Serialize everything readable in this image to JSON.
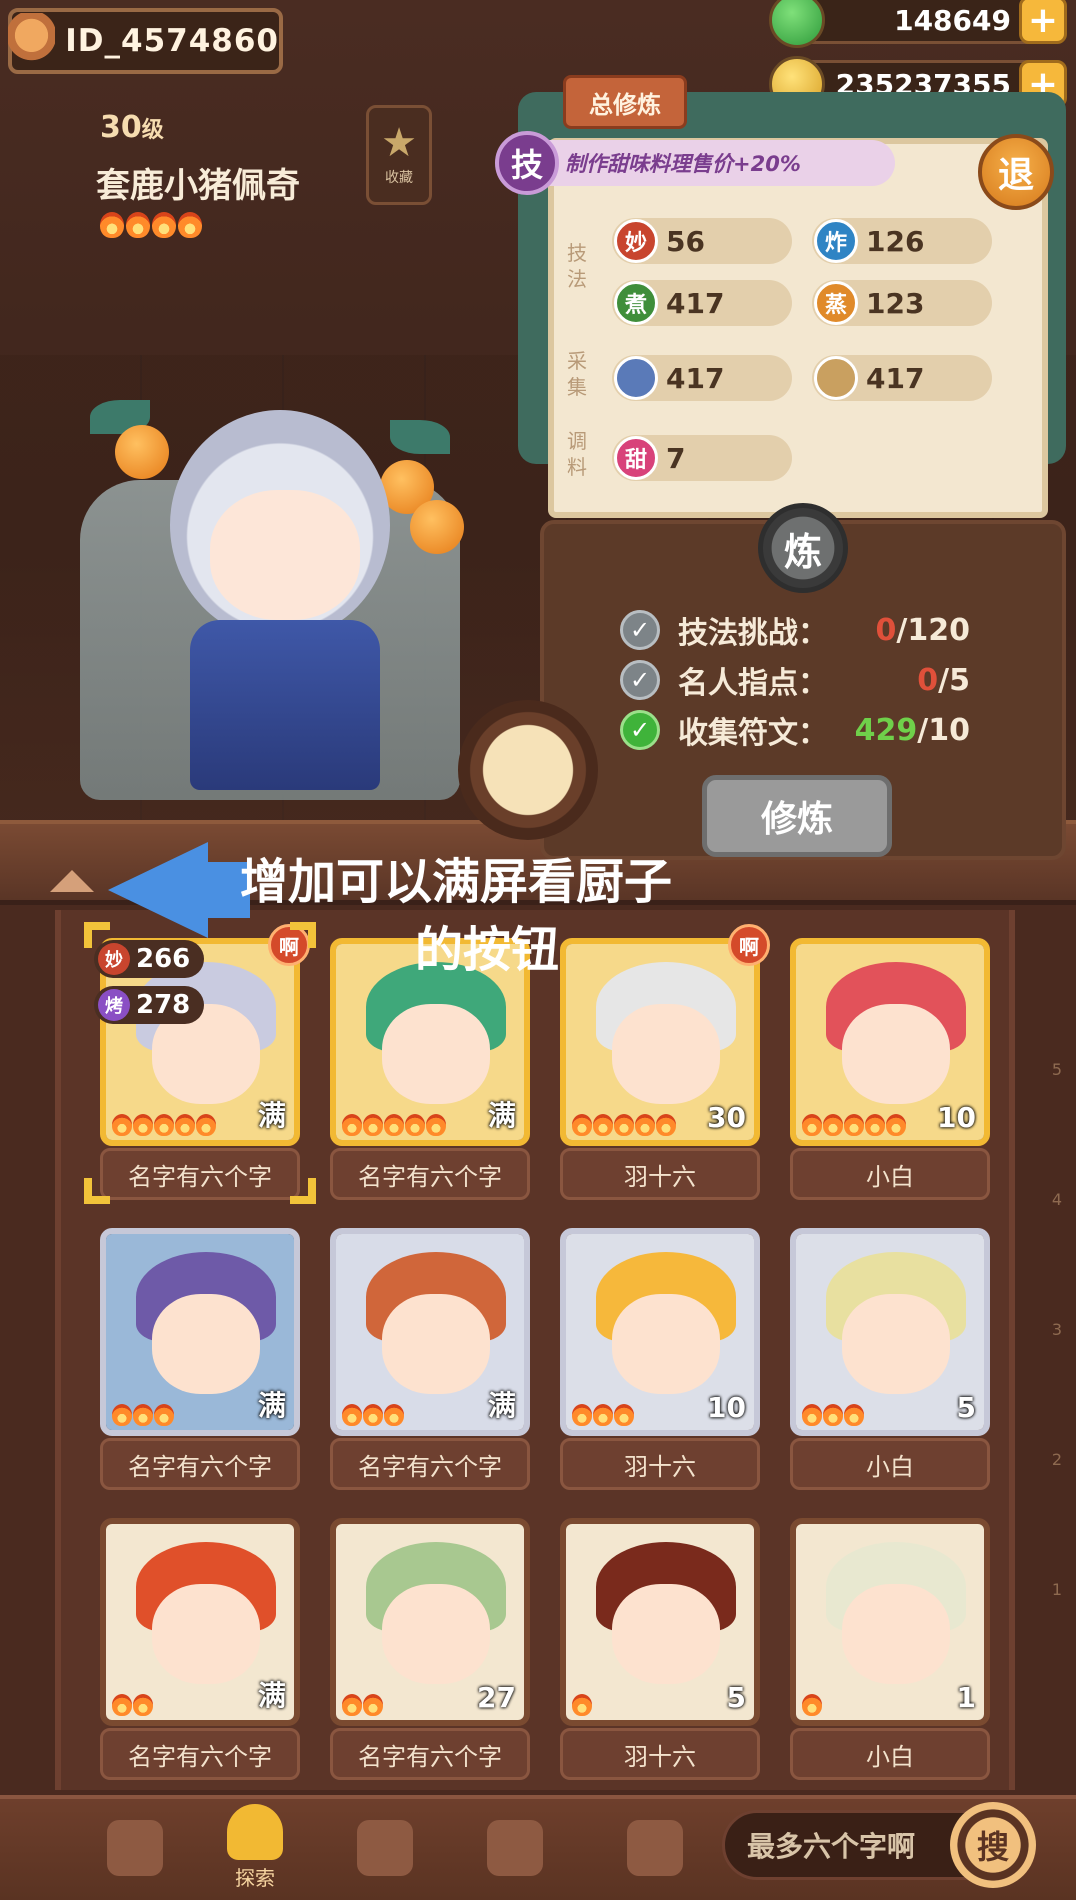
{
  "header": {
    "player_id": "ID_4574860",
    "currency_1": {
      "value": "148649",
      "icon": "jade-coin-icon"
    },
    "currency_2": {
      "value": "235237355",
      "icon": "gold-coin-icon"
    },
    "plus_label": "+"
  },
  "chef": {
    "level_number": "30",
    "level_suffix": "级",
    "name": "套鹿小猪佩奇",
    "flames": 4,
    "collect_label": "收藏"
  },
  "board": {
    "total_btn": "总修炼",
    "buff_badge": "技",
    "buff_text": "制作甜味料理售价+20%",
    "quit_btn": "退",
    "categories": {
      "technique": "技法",
      "gather": "采集",
      "season": "调料"
    },
    "stats": [
      {
        "icon": "妙",
        "value": "56",
        "color": "#c8452e"
      },
      {
        "icon": "炸",
        "value": "126",
        "color": "#2f84c4"
      },
      {
        "icon": "煮",
        "value": "417",
        "color": "#3f8e3a"
      },
      {
        "icon": "蒸",
        "value": "123",
        "color": "#e08a2a"
      },
      {
        "icon": "",
        "value": "417",
        "color": "#5a7ab8"
      },
      {
        "icon": "",
        "value": "417",
        "color": "#c9a060"
      },
      {
        "icon": "甜",
        "value": "7",
        "color": "#d8427a"
      }
    ]
  },
  "training": {
    "badge": "炼",
    "tasks": [
      {
        "label": "技法挑战：",
        "current": "0",
        "total": "/120",
        "done": false
      },
      {
        "label": "名人指点：",
        "current": "0",
        "total": "/5",
        "done": false
      },
      {
        "label": "收集符文：",
        "current": "429",
        "total": "/10",
        "done": true
      }
    ],
    "check_mark": "✓",
    "button": "修炼"
  },
  "annotation": {
    "line1": "增加可以满屏看厨子",
    "line2": "的按钮"
  },
  "selected_skills": [
    {
      "icon": "妙",
      "value": "266",
      "color": "#c8452e"
    },
    {
      "icon": "烤",
      "value": "278",
      "color": "#8a4fc4"
    }
  ],
  "cards": [
    {
      "name": "名字有六个字",
      "level": "满",
      "flames": 5,
      "frame": "gold",
      "tag": "啊",
      "hair": "#c9cbe0",
      "bg": "#f6d98a",
      "selected": true
    },
    {
      "name": "名字有六个字",
      "level": "满",
      "flames": 5,
      "frame": "gold",
      "tag": "",
      "hair": "#3fa87a",
      "bg": "#f6d98a",
      "selected": false
    },
    {
      "name": "羽十六",
      "level": "30",
      "flames": 5,
      "frame": "gold",
      "tag": "啊",
      "hair": "#e6e6e6",
      "bg": "#f6d98a",
      "selected": false
    },
    {
      "name": "小白",
      "level": "10",
      "flames": 5,
      "frame": "gold",
      "tag": "",
      "hair": "#e2525a",
      "bg": "#f6d98a",
      "selected": false
    },
    {
      "name": "名字有六个字",
      "level": "满",
      "flames": 3,
      "frame": "silver",
      "tag": "",
      "hair": "#6e5aa8",
      "bg": "#9ab8d8",
      "selected": false
    },
    {
      "name": "名字有六个字",
      "level": "满",
      "flames": 3,
      "frame": "silver",
      "tag": "",
      "hair": "#d0663a",
      "bg": "#d8dce8",
      "selected": false
    },
    {
      "name": "羽十六",
      "level": "10",
      "flames": 3,
      "frame": "silver",
      "tag": "",
      "hair": "#f6b83b",
      "bg": "#dcdfe8",
      "selected": false
    },
    {
      "name": "小白",
      "level": "5",
      "flames": 3,
      "frame": "silver",
      "tag": "",
      "hair": "#e8e0a0",
      "bg": "#dcdfe8",
      "selected": false
    },
    {
      "name": "名字有六个字",
      "level": "满",
      "flames": 2,
      "frame": "bronze",
      "tag": "",
      "hair": "#e0502a",
      "bg": "#f3e7d0",
      "selected": false
    },
    {
      "name": "名字有六个字",
      "level": "27",
      "flames": 2,
      "frame": "bronze",
      "tag": "",
      "hair": "#a8c890",
      "bg": "#f3e7d0",
      "selected": false
    },
    {
      "name": "羽十六",
      "level": "5",
      "flames": 1,
      "frame": "bronze",
      "tag": "",
      "hair": "#7a2a1c",
      "bg": "#f3e7d0",
      "selected": false
    },
    {
      "name": "小白",
      "level": "1",
      "flames": 1,
      "frame": "bronze",
      "tag": "",
      "hair": "#e8e8d0",
      "bg": "#f3e7d0",
      "selected": false
    }
  ],
  "ruler": [
    "5",
    "4",
    "3",
    "2",
    "1"
  ],
  "nav": {
    "items": [
      {
        "name": "hammer",
        "label": ""
      },
      {
        "name": "explore",
        "label": "探索"
      },
      {
        "name": "jar",
        "label": ""
      },
      {
        "name": "map",
        "label": ""
      },
      {
        "name": "puzzle",
        "label": ""
      }
    ],
    "search_placeholder": "最多六个字啊",
    "search_btn": "搜"
  }
}
